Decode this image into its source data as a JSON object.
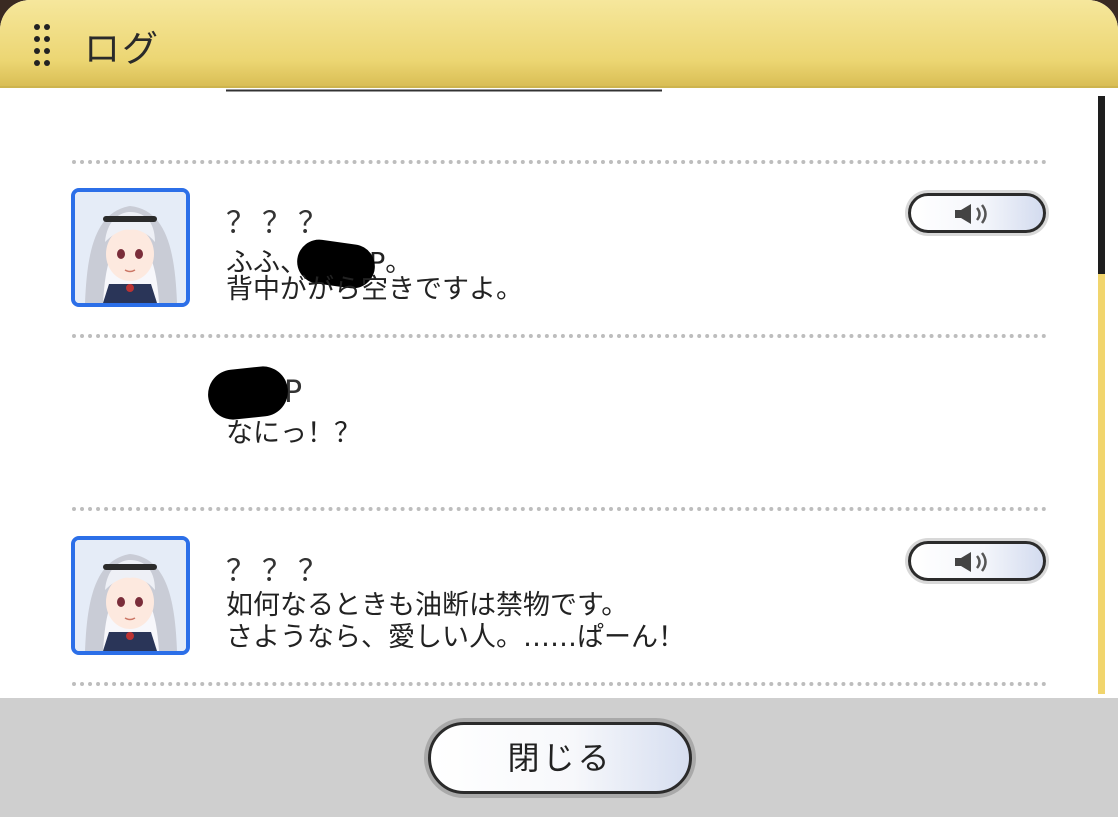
{
  "window": {
    "title": "ログ"
  },
  "log": {
    "partial_top_text": "――――――――――――――――――",
    "entries": [
      {
        "speaker": "？？？",
        "line1_prefix": "ふふ、",
        "line1_suffix": "P。",
        "line2": "背中ががら空きですよ。",
        "voice_icon": "speaker-icon"
      },
      {
        "speaker_suffix": "P",
        "line1": "なにっ！？"
      },
      {
        "speaker": "？？？",
        "line1": "如何なるときも油断は禁物です。",
        "line2": "さようなら、愛しい人。……ぱーん！",
        "voice_icon": "speaker-icon"
      }
    ]
  },
  "footer": {
    "close_label": "閉じる"
  },
  "colors": {
    "title_bar": "#ecd673",
    "avatar_border": "#2c6fe8",
    "scrollbar": "#f1d56d"
  }
}
